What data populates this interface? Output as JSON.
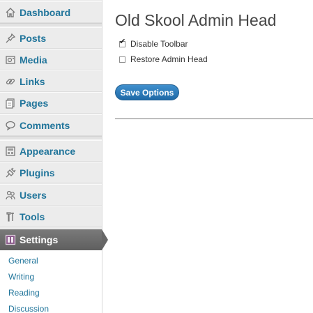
{
  "sidebar": {
    "items": [
      {
        "label": "Dashboard",
        "icon": "dashboard-icon"
      },
      {
        "label": "Posts",
        "icon": "pin-icon"
      },
      {
        "label": "Media",
        "icon": "media-icon"
      },
      {
        "label": "Links",
        "icon": "link-icon"
      },
      {
        "label": "Pages",
        "icon": "pages-icon"
      },
      {
        "label": "Comments",
        "icon": "comment-icon"
      },
      {
        "label": "Appearance",
        "icon": "appearance-icon"
      },
      {
        "label": "Plugins",
        "icon": "plug-icon"
      },
      {
        "label": "Users",
        "icon": "users-icon"
      },
      {
        "label": "Tools",
        "icon": "tools-icon"
      },
      {
        "label": "Settings",
        "icon": "settings-icon",
        "active": true
      }
    ],
    "submenu": [
      "General",
      "Writing",
      "Reading",
      "Discussion"
    ]
  },
  "main": {
    "title": "Old Skool Admin Head",
    "options": [
      {
        "label": "Disable Toolbar",
        "checked": true
      },
      {
        "label": "Restore Admin Head",
        "checked": false
      }
    ],
    "save_label": "Save Options"
  },
  "colors": {
    "link": "#21759b",
    "sidebar_bg": "#ececec",
    "active_bg": "#676767",
    "button": "#2a7bbd"
  }
}
